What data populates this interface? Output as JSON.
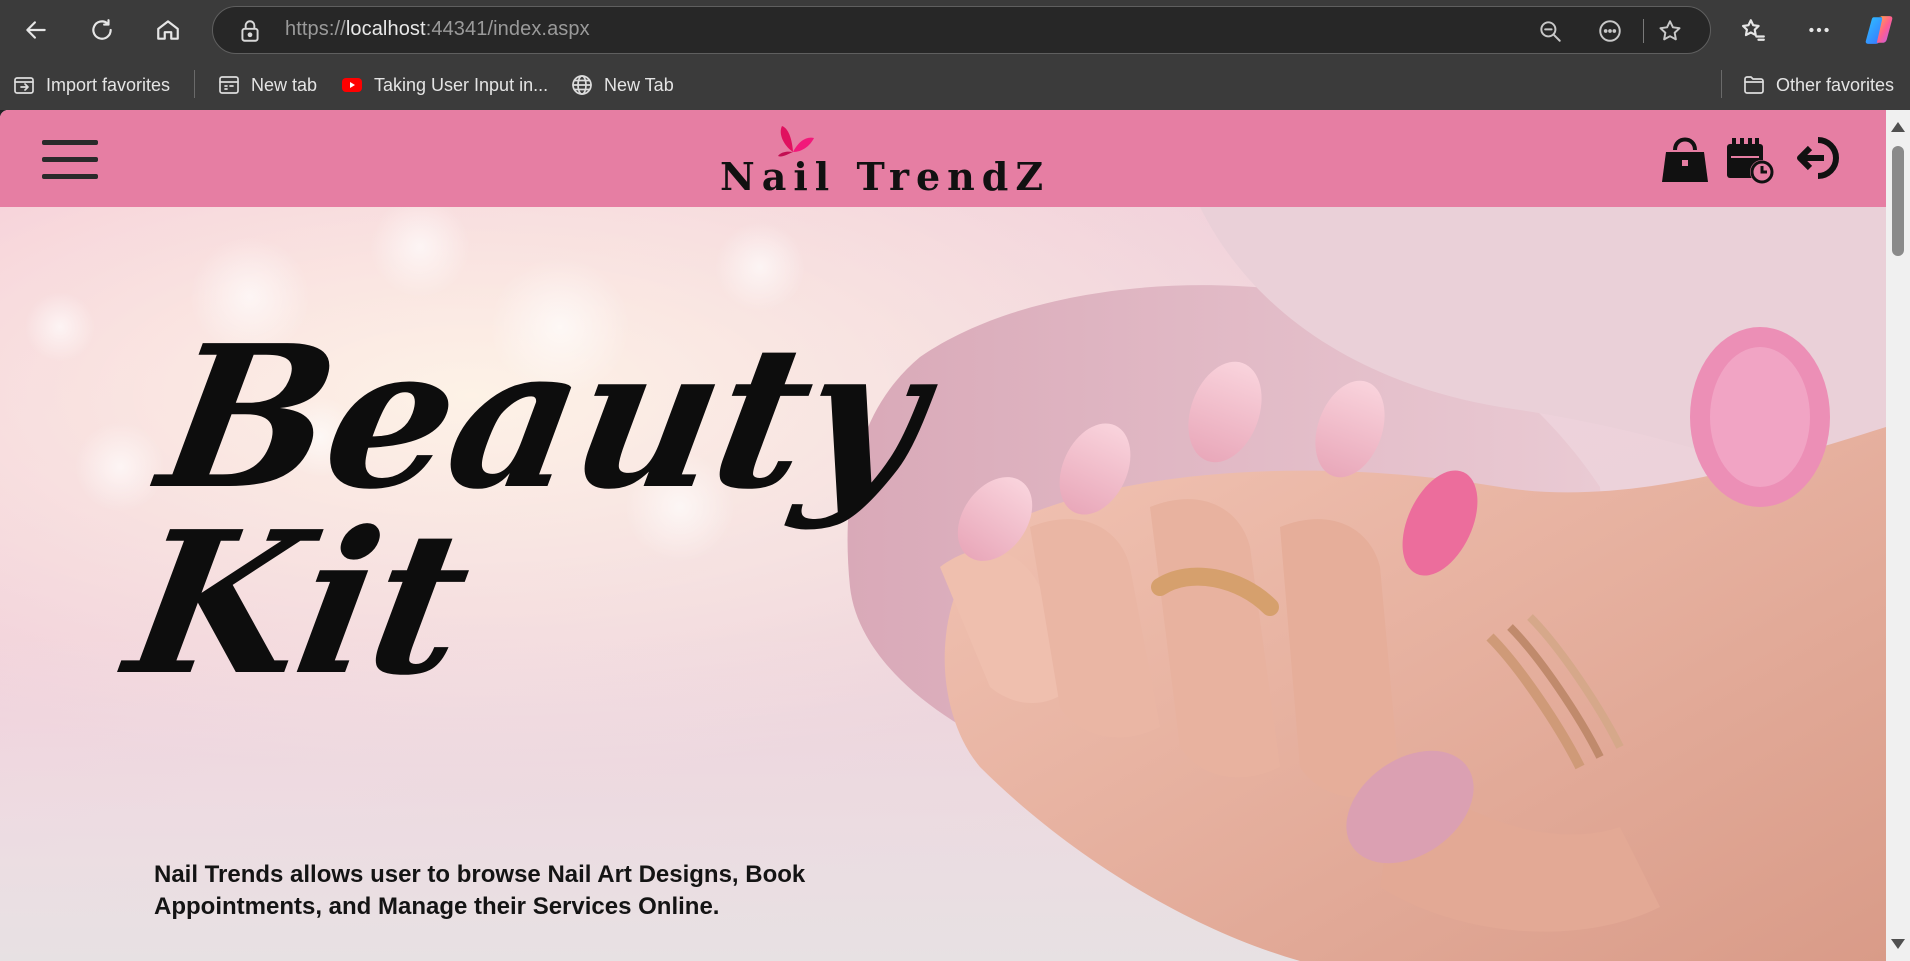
{
  "browser": {
    "url_prefix": "https://",
    "url_host": "localhost",
    "url_rest": ":44341/index.aspx",
    "favorites": [
      {
        "label": "Import favorites",
        "icon": "import-icon"
      },
      {
        "label": "New tab",
        "icon": "new-tab-icon"
      },
      {
        "label": "Taking User Input in...",
        "icon": "youtube-icon"
      },
      {
        "label": "New Tab",
        "icon": "globe-icon"
      }
    ],
    "other_favorites": "Other favorites"
  },
  "site": {
    "logo_text": "Nail TrendZ",
    "accent_color": "#e67ea3",
    "hero": {
      "title_line1": "Beauty",
      "title_line2": "Kit",
      "description": "Nail Trends allows user to browse Nail Art Designs, Book Appointments, and Manage their Services Online."
    }
  }
}
